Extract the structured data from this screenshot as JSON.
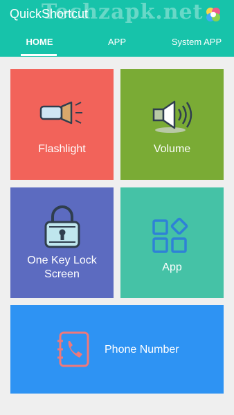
{
  "header": {
    "app_title": "QuickShortcut",
    "watermark": "Techzapk.net"
  },
  "tabs": [
    {
      "label": "HOME"
    },
    {
      "label": "APP"
    },
    {
      "label": "System APP"
    }
  ],
  "tiles": {
    "flashlight": {
      "label": "Flashlight",
      "icon": "flashlight-icon",
      "color": "#f2635a"
    },
    "volume": {
      "label": "Volume",
      "icon": "speaker-icon",
      "color": "#7aab35"
    },
    "lock": {
      "label": "One Key Lock Screen",
      "line1": "One Key Lock",
      "line2": "Screen",
      "icon": "padlock-icon",
      "color": "#5c6bc0"
    },
    "app": {
      "label": "App",
      "icon": "app-grid-icon",
      "color": "#45c2a6"
    },
    "phone": {
      "label": "Phone Number",
      "icon": "phonebook-icon",
      "color": "#2e93f3"
    }
  },
  "colors": {
    "appbar": "#17c3aa",
    "background": "#efefef"
  }
}
